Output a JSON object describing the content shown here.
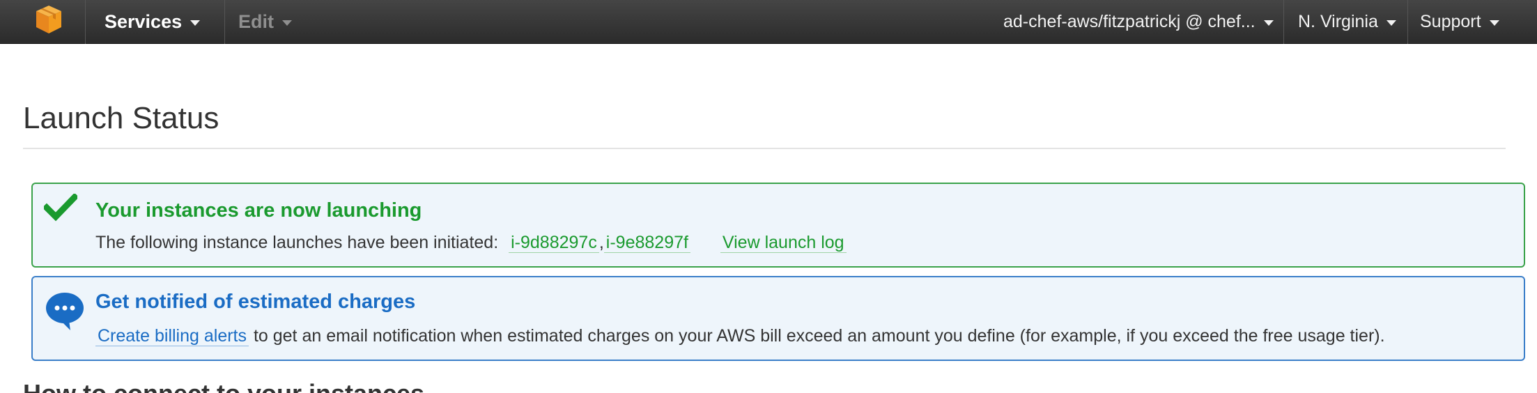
{
  "topnav": {
    "services_label": "Services",
    "edit_label": "Edit",
    "account_label": "ad-chef-aws/fitzpatrickj @ chef...",
    "region_label": "N. Virginia",
    "support_label": "Support"
  },
  "page": {
    "title": "Launch Status"
  },
  "success_alert": {
    "heading": "Your instances are now launching",
    "body_prefix": "The following instance launches have been initiated:",
    "instances": [
      "i-9d88297c",
      "i-9e88297f"
    ],
    "separator": ",",
    "view_log_label": "View launch log"
  },
  "billing_alert": {
    "heading": "Get notified of estimated charges",
    "link_label": "Create billing alerts",
    "body_suffix": "to get an email notification when estimated charges on your AWS bill exceed an amount you define (for example, if you exceed the free usage tier)."
  },
  "connect_section": {
    "heading": "How to connect to your instances"
  },
  "colors": {
    "success": "#1a9a2e",
    "info": "#1a6cc4",
    "logo": "#f39c1f",
    "navbar": "#333333"
  },
  "icons": {
    "logo": "aws-cube-logo",
    "success": "checkmark-icon",
    "info": "speech-bubble-icon"
  }
}
